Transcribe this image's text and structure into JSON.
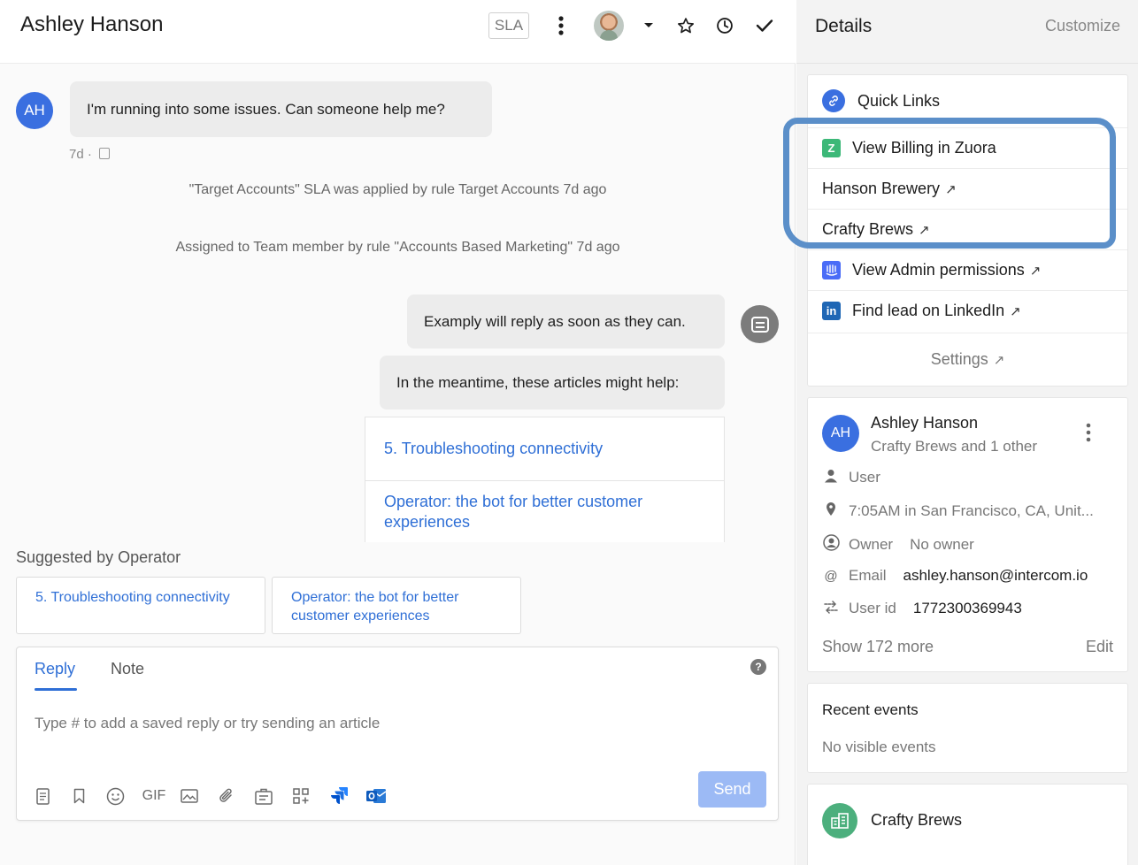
{
  "header": {
    "title": "Ashley Hanson",
    "sla_label": "SLA"
  },
  "conversation": {
    "user_initials": "AH",
    "user_message": "I'm running into some issues. Can someone help me?",
    "message_age": "7d ·",
    "events": [
      "\"Target Accounts\" SLA was applied by rule Target Accounts 7d ago",
      "Assigned to Team member by rule \"Accounts Based Marketing\" 7d ago"
    ],
    "bot_messages": [
      "Examply will reply as soon as they can.",
      "In the meantime, these articles might help:"
    ],
    "articles": [
      "5. Troubleshooting connectivity",
      "Operator: the bot for better customer experiences"
    ]
  },
  "suggested": {
    "label": "Suggested by Operator",
    "items": [
      "5. Troubleshooting connectivity",
      "Operator: the bot for better customer experiences"
    ]
  },
  "composer": {
    "tabs": [
      "Reply",
      "Note"
    ],
    "placeholder": "Type # to add a saved reply or try sending an article",
    "gif_label": "GIF",
    "send_label": "Send",
    "help_glyph": "?"
  },
  "details": {
    "title": "Details",
    "customize_label": "Customize",
    "quick_links": {
      "title": "Quick Links",
      "items": [
        {
          "label": "View Billing in Zuora",
          "icon": "zuora-icon",
          "color": "#3cb878"
        },
        {
          "label": "Hanson Brewery",
          "icon": "",
          "color": ""
        },
        {
          "label": "Crafty Brews",
          "icon": "",
          "color": ""
        },
        {
          "label": "View Admin permissions",
          "icon": "intercom-icon",
          "color": "#4a6cf7"
        },
        {
          "label": "Find lead on LinkedIn",
          "icon": "linkedin-icon",
          "color": "#1f67b5"
        }
      ],
      "settings_label": "Settings"
    },
    "user_card": {
      "initials": "AH",
      "name": "Ashley Hanson",
      "subtitle": "Crafty Brews and 1 other",
      "attributes": [
        {
          "icon": "person-icon",
          "label": "User",
          "value": ""
        },
        {
          "icon": "location-pin-icon",
          "label": "7:05AM in San Francisco, CA, Unit...",
          "value": ""
        },
        {
          "icon": "owner-icon",
          "label": "Owner",
          "value": "No owner"
        },
        {
          "icon": "at-icon",
          "label": "Email",
          "value": "ashley.hanson@intercom.io"
        },
        {
          "icon": "user-id-icon",
          "label": "User id",
          "value": "1772300369943"
        }
      ],
      "show_more_label": "Show 172 more",
      "edit_label": "Edit"
    },
    "recent_events": {
      "title": "Recent events",
      "empty_text": "No visible events"
    },
    "company_card": {
      "name": "Crafty Brews",
      "icon_color": "#4caf7d"
    }
  }
}
